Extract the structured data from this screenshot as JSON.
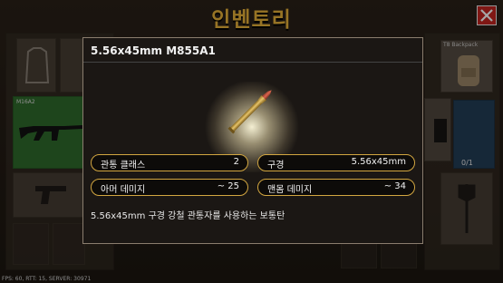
{
  "header": {
    "title": "인벤토리"
  },
  "inventory": {
    "left_weapon_label": "M16A2",
    "right_slot_label": "T8 Backpack",
    "ammo_count": "0/1"
  },
  "debug": {
    "fps_text": "FPS: 60, RTT: 15, SERVER: 30971"
  },
  "item_dialog": {
    "name": "5.56x45mm M855A1",
    "stats": [
      {
        "key": "관통 클래스",
        "value": "2"
      },
      {
        "key": "구경",
        "value": "5.56x45mm"
      },
      {
        "key": "아머 데미지",
        "value": "~ 25"
      },
      {
        "key": "맨몸 데미지",
        "value": "~ 34"
      }
    ],
    "description": "5.56x45mm 구경 강철 관통자를 사용하는 보통탄"
  },
  "colors": {
    "accent_gold": "#d2a640",
    "title_gold": "#e9b23a",
    "close_red": "#c4241f",
    "slot_green": "#2f6b2b"
  }
}
